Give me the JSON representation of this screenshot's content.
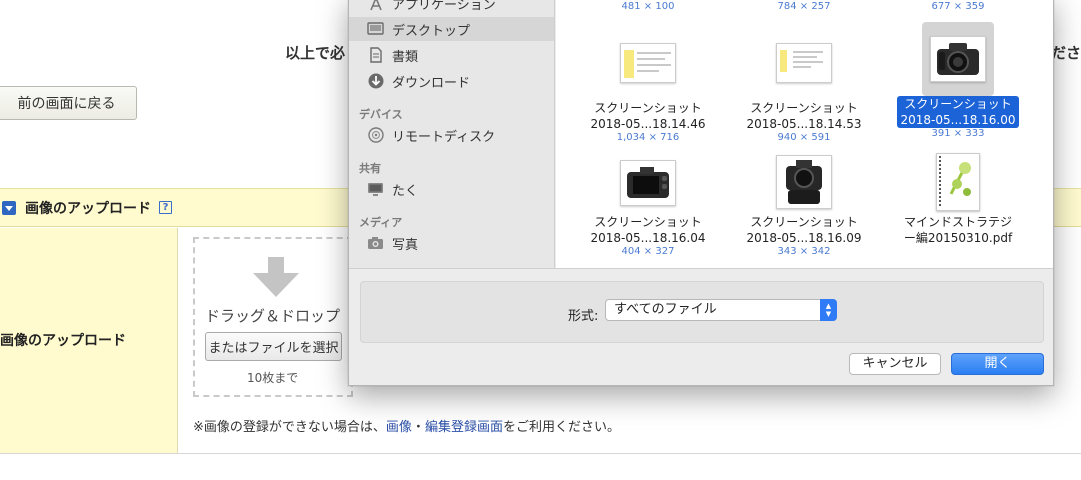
{
  "page": {
    "heading_left": "以上で必",
    "heading_right": "ださ",
    "back_button": "前の画面に戻る",
    "section_title": "画像のアップロード",
    "help_icon": "?",
    "row_label": "画像のアップロード",
    "drop_text": "ドラッグ＆ドロップ",
    "select_file_button": "またはファイルを選択",
    "limit_text": "10枚まで",
    "note_prefix": "※画像の登録ができない場合は、",
    "note_link1": "画像",
    "note_sep": "・",
    "note_link2": "編集登録画面",
    "note_suffix": "をご利用ください。"
  },
  "dialog": {
    "sidebar": {
      "items_top": [
        {
          "label": "アプリケーション",
          "icon": "applications-icon"
        },
        {
          "label": "デスクトップ",
          "icon": "desktop-icon",
          "selected": true
        },
        {
          "label": "書類",
          "icon": "documents-icon"
        },
        {
          "label": "ダウンロード",
          "icon": "downloads-icon"
        }
      ],
      "devices_header": "デバイス",
      "devices": [
        {
          "label": "リモートディスク",
          "icon": "remote-disc-icon"
        }
      ],
      "shared_header": "共有",
      "shared": [
        {
          "label": "たく",
          "icon": "computer-icon"
        }
      ],
      "media_header": "メディア",
      "media": [
        {
          "label": "写真",
          "icon": "camera-icon"
        }
      ]
    },
    "top_dims": [
      "481 × 100",
      "784 × 257",
      "677 × 359"
    ],
    "files": [
      {
        "name1": "スクリーンショット",
        "name2": "2018-05...18.14.46",
        "dim": "1,034 × 716",
        "kind": "doc"
      },
      {
        "name1": "スクリーンショット",
        "name2": "2018-05...18.14.53",
        "dim": "940 × 591",
        "kind": "doc"
      },
      {
        "name1": "スクリーンショット",
        "name2": "2018-05...18.16.00",
        "dim": "391 × 333",
        "kind": "camera",
        "selected": true
      },
      {
        "name1": "スクリーンショット",
        "name2": "2018-05...18.16.04",
        "dim": "404 × 327",
        "kind": "camera"
      },
      {
        "name1": "スクリーンショット",
        "name2": "2018-05...18.16.09",
        "dim": "343 × 342",
        "kind": "camera"
      },
      {
        "name1": "マインドストラテジ",
        "name2": "ー編20150310.pdf",
        "dim": "",
        "kind": "pdf"
      }
    ],
    "format_label": "形式:",
    "format_value": "すべてのファイル",
    "cancel_button": "キャンセル",
    "open_button": "開く"
  },
  "colors": {
    "accent": "#2f7cf6",
    "selection": "#1b63d6",
    "section_bg": "#fffbcf",
    "link": "#2a4fa8"
  }
}
